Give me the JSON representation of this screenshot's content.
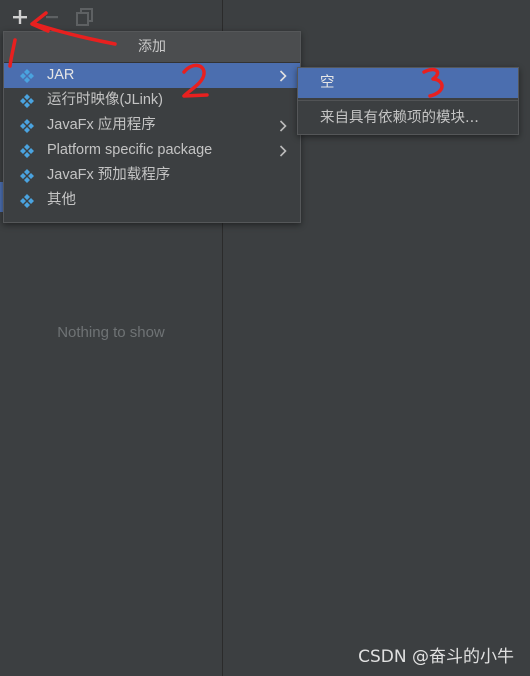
{
  "popup": {
    "title": "添加",
    "items": [
      {
        "label": "JAR",
        "icon": "module-icon",
        "has_submenu": true,
        "selected": true
      },
      {
        "label": "运行时映像(JLink)",
        "icon": "module-icon",
        "has_submenu": false
      },
      {
        "label": "JavaFx 应用程序",
        "icon": "module-icon",
        "has_submenu": true
      },
      {
        "label": "Platform specific package",
        "icon": "module-icon",
        "has_submenu": true
      },
      {
        "label": "JavaFx 预加载程序",
        "icon": "module-icon",
        "has_submenu": false
      },
      {
        "label": "其他",
        "icon": "module-icon",
        "has_submenu": false
      }
    ]
  },
  "submenu": {
    "items": [
      {
        "label": "空",
        "selected": true
      },
      {
        "label": "来自具有依赖项的模块..."
      }
    ]
  },
  "left_panel": {
    "empty_text": "Nothing to show"
  },
  "annotations": {
    "marks": [
      "1",
      "2",
      "3"
    ],
    "color": "#e8201f"
  },
  "watermark": "CSDN @奋斗的小牛",
  "colors": {
    "background": "#3c3f41",
    "selection": "#4b6eaf",
    "icon": "#4aa3df"
  }
}
